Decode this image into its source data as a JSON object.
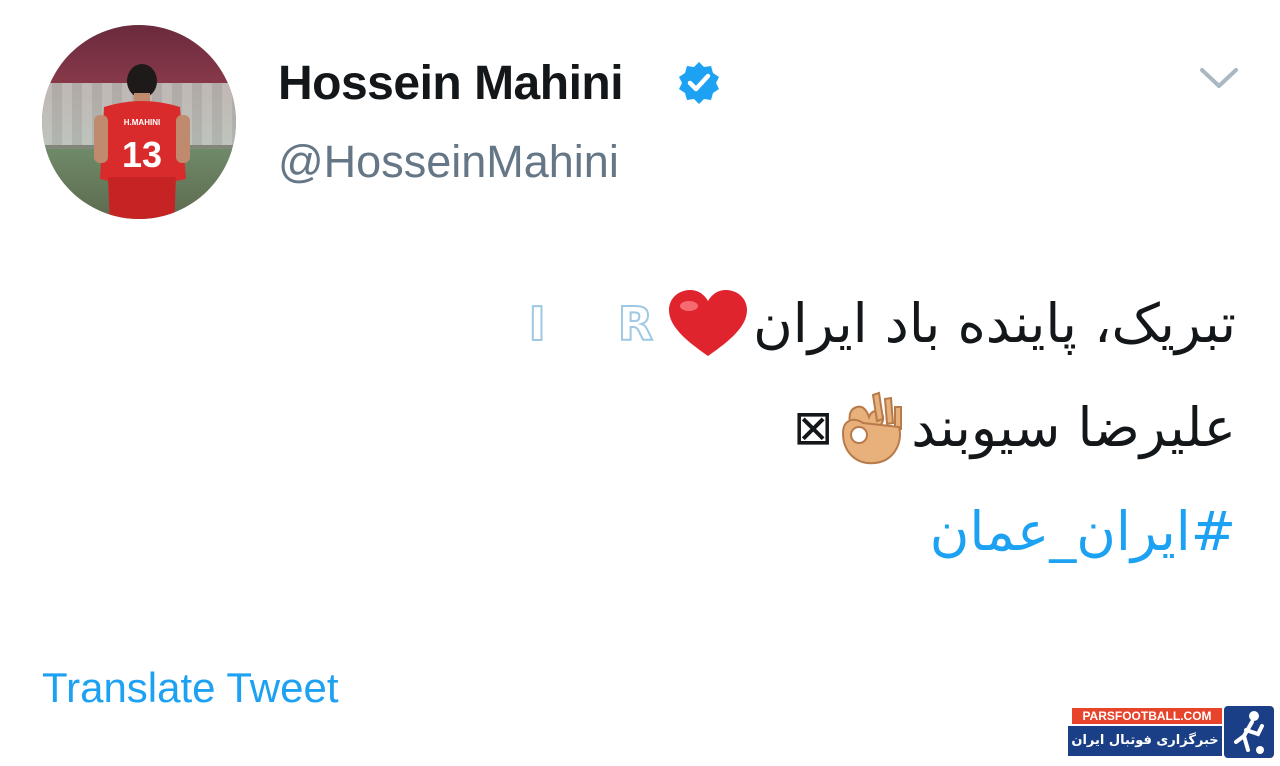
{
  "user": {
    "display_name": "Hossein Mahini",
    "handle": "@HosseinMahini",
    "verified": true,
    "jersey_name": "H.MAHINI",
    "jersey_number": "13"
  },
  "tweet": {
    "line1_text": "تبریک، پاینده باد ایران",
    "line1_flag_letters": [
      "R",
      "I"
    ],
    "line2_text": "علیرضا سیوبند",
    "line2_missing_glyph": "⊠",
    "hashtag": "#ایران_عمان"
  },
  "actions": {
    "translate_label": "Translate Tweet"
  },
  "watermark": {
    "top_text": "PARSFOOTBALL.COM",
    "bottom_text": "خبرگزاری فوتبال ایران"
  },
  "colors": {
    "link": "#1da1f2",
    "text": "#14171a",
    "secondary": "#657786",
    "verified": "#1da1f2",
    "heart": "#e0242d",
    "jersey": "#d92b2b"
  }
}
